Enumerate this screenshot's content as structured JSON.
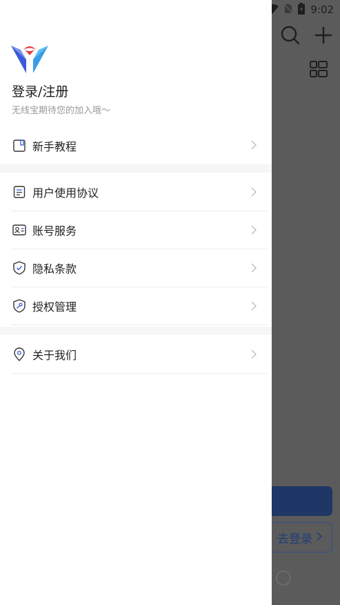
{
  "status_bar": {
    "time": "9:02"
  },
  "background": {
    "login_button_label": "去登录"
  },
  "drawer": {
    "title": "登录/注册",
    "subtitle": "无线宝期待您的加入哦～",
    "groups": [
      {
        "items": [
          {
            "label": "新手教程",
            "icon": "tutorial-icon"
          }
        ]
      },
      {
        "items": [
          {
            "label": "用户使用协议",
            "icon": "document-icon"
          },
          {
            "label": "账号服务",
            "icon": "id-card-icon"
          },
          {
            "label": "隐私条款",
            "icon": "shield-check-icon"
          },
          {
            "label": "授权管理",
            "icon": "shield-key-icon"
          }
        ]
      },
      {
        "items": [
          {
            "label": "关于我们",
            "icon": "location-pin-icon"
          }
        ]
      }
    ]
  },
  "colors": {
    "accent_blue": "#3a5bd9",
    "logo_red": "#e23b3b",
    "dim_overlay": "#5b5b5b",
    "primary_button": "#1f3766"
  }
}
